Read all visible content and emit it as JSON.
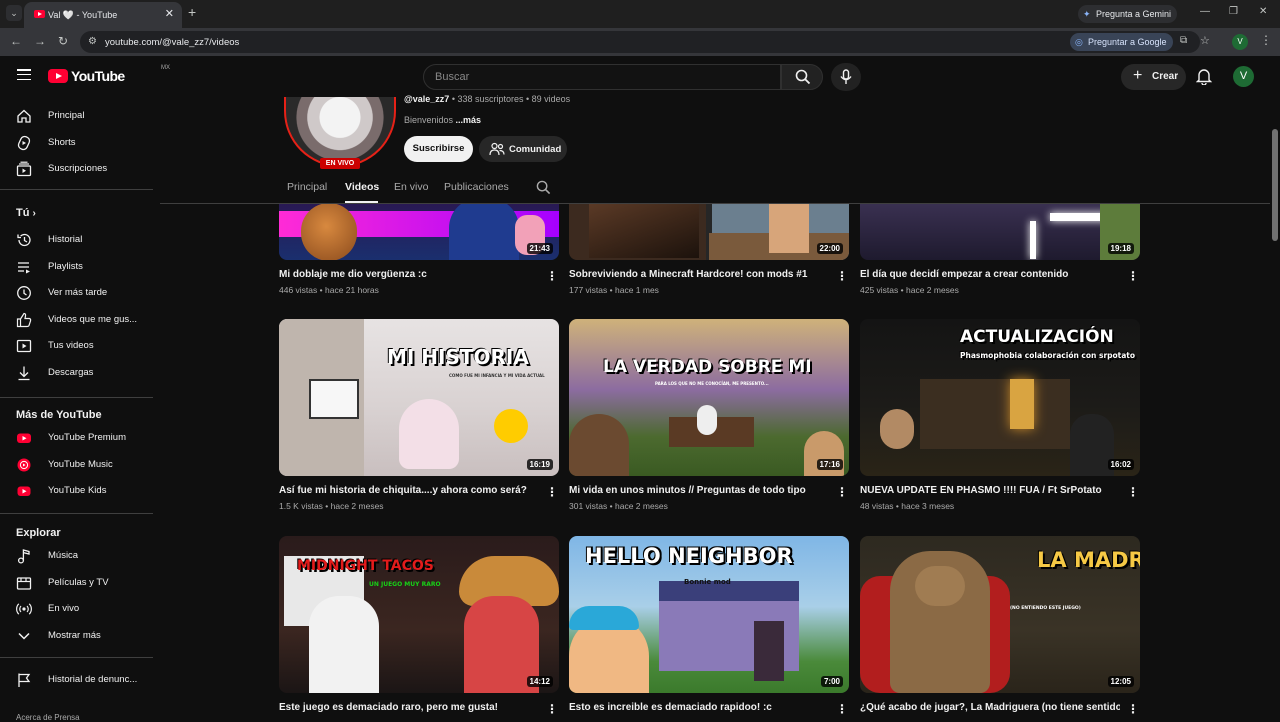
{
  "browser": {
    "tab_title": "Val 🤍 - YouTube",
    "new_tab": "+",
    "url": "youtube.com/@vale_zz7/videos",
    "gemini_label": "Pregunta a Gemini",
    "ask_google_label": "Preguntar a Google",
    "profile_initial": "V"
  },
  "masthead": {
    "logo_text": "YouTube",
    "country_code": "MX",
    "search_placeholder": "Buscar",
    "create_label": "Crear",
    "avatar_initial": "V"
  },
  "sidebar": {
    "main": [
      {
        "label": "Principal",
        "icon": "home-icon"
      },
      {
        "label": "Shorts",
        "icon": "shorts-icon"
      },
      {
        "label": "Suscripciones",
        "icon": "subscriptions-icon"
      }
    ],
    "you_header": "Tú",
    "you": [
      {
        "label": "Historial",
        "icon": "history-icon"
      },
      {
        "label": "Playlists",
        "icon": "playlists-icon"
      },
      {
        "label": "Ver más tarde",
        "icon": "clock-icon"
      },
      {
        "label": "Videos que me gus...",
        "icon": "thumbs-up-icon"
      },
      {
        "label": "Tus videos",
        "icon": "your-videos-icon"
      },
      {
        "label": "Descargas",
        "icon": "download-icon"
      }
    ],
    "more_header": "Más de YouTube",
    "more": [
      {
        "label": "YouTube Premium",
        "icon": "youtube-premium-icon"
      },
      {
        "label": "YouTube Music",
        "icon": "youtube-music-icon"
      },
      {
        "label": "YouTube Kids",
        "icon": "youtube-kids-icon"
      }
    ],
    "explore_header": "Explorar",
    "explore": [
      {
        "label": "Música",
        "icon": "music-icon"
      },
      {
        "label": "Películas y TV",
        "icon": "movies-icon"
      },
      {
        "label": "En vivo",
        "icon": "live-icon"
      },
      {
        "label": "Mostrar más",
        "icon": "chevron-down-icon"
      }
    ],
    "report_history": "Historial de denunc...",
    "footer": "Acerca de  Prensa"
  },
  "channel": {
    "handle": "@vale_zz7",
    "stats": " • 338 suscriptores • 89 videos",
    "desc_prefix": "Bienvenidos ",
    "desc_more": "...más",
    "live_badge": "EN VIVO",
    "subscribe_label": "Suscribirse",
    "community_label": "Comunidad",
    "tabs": [
      "Principal",
      "Videos",
      "En vivo",
      "Publicaciones"
    ]
  },
  "videos": [
    {
      "title": "Mi doblaje me dio vergüenza :c",
      "views": "446 vistas",
      "age": "hace 21 horas",
      "duration": "21:43"
    },
    {
      "title": "Sobreviviendo a Minecraft Hardcore! con mods #1",
      "views": "177 vistas",
      "age": "hace 1 mes",
      "duration": "22:00"
    },
    {
      "title": "El día que decidí empezar a crear contenido",
      "views": "425 vistas",
      "age": "hace 2 meses",
      "duration": "19:18"
    },
    {
      "title": "Así fue mi historia de chiquita....y ahora como será?",
      "views": "1.5 K vistas",
      "age": "hace 2 meses",
      "duration": "16:19",
      "thumb_text": "MI HISTORIA",
      "thumb_sub": "COMO FUE MI INFANCIA Y MI VIDA ACTUAL"
    },
    {
      "title": "Mi vida en unos minutos // Preguntas de todo tipo",
      "views": "301 vistas",
      "age": "hace 2 meses",
      "duration": "17:16",
      "thumb_text": "LA VERDAD SOBRE MI",
      "thumb_sub": "PARA LOS QUE NO ME CONOCÍAN, ME PRESENTO..."
    },
    {
      "title": "NUEVA UPDATE EN PHASMO !!!! FUA / Ft SrPotato",
      "views": "48 vistas",
      "age": "hace 3 meses",
      "duration": "16:02",
      "thumb_text": "ACTUALIZACIÓN",
      "thumb_sub": "Phasmophobia colaboración con srpotato"
    },
    {
      "title": "Este juego es demaciado raro, pero me gusta!",
      "views": "",
      "age": "",
      "duration": "14:12",
      "thumb_text": "MIDNIGHT TACOS",
      "thumb_sub": "UN JUEGO MUY RARO"
    },
    {
      "title": "Esto es increible es demaciado rapidoo! :c",
      "views": "",
      "age": "",
      "duration": "7:00",
      "thumb_text": "HELLO NEIGHBOR",
      "thumb_sub": "Bonnie mod"
    },
    {
      "title": "¿Qué acabo de jugar?, La Madriguera (no tiene sentido)",
      "views": "",
      "age": "",
      "duration": "12:05",
      "thumb_text": "LA MADRIGUERA",
      "thumb_sub": "(NO ENTIENDO ESTE JUEGO)"
    }
  ],
  "colors": {
    "background": "#0f0f0f",
    "brand_red": "#ff0033",
    "live_red": "#cc0000",
    "text_primary": "#f1f1f1",
    "text_secondary": "#aaaaaa"
  }
}
